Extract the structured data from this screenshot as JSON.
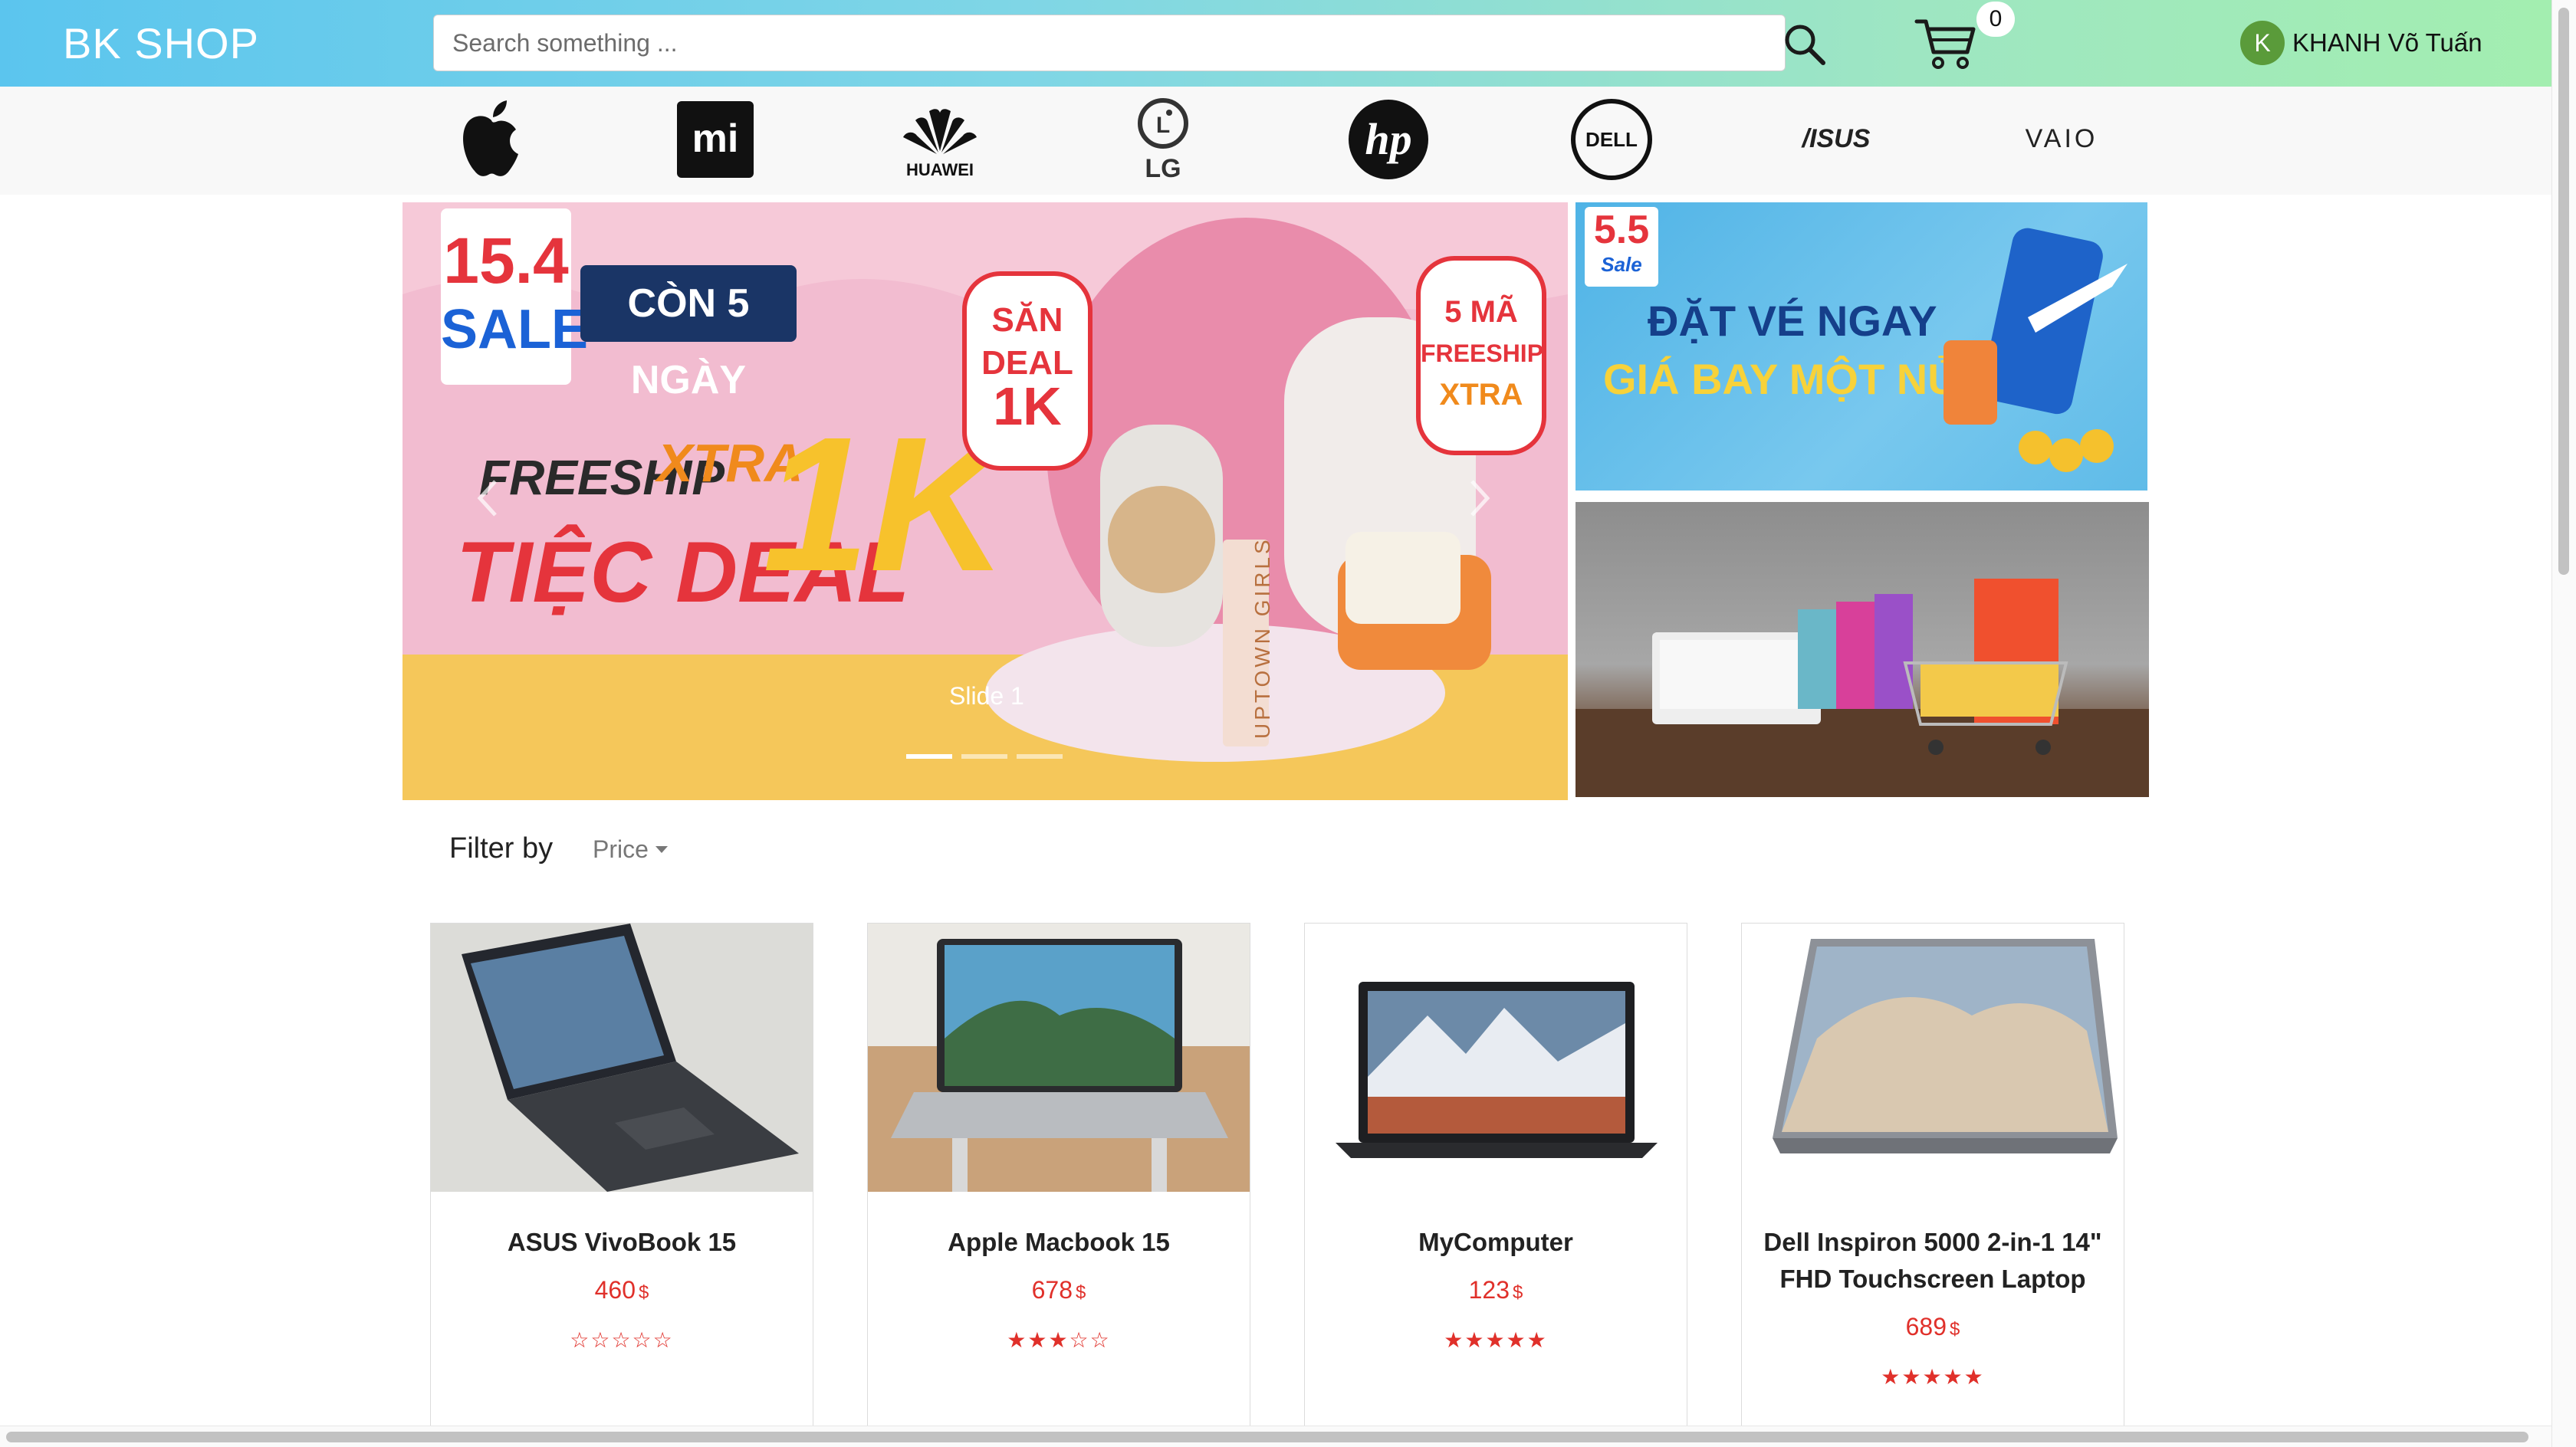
{
  "header": {
    "brand": "BK SHOP",
    "search_placeholder": "Search something ...",
    "cart_count": "0",
    "user_initial": "K",
    "user_name": "KHANH Võ Tuấn"
  },
  "brands": [
    {
      "name": "apple",
      "label": ""
    },
    {
      "name": "xiaomi",
      "label": "mi"
    },
    {
      "name": "huawei",
      "label": "HUAWEI"
    },
    {
      "name": "lg",
      "label": "LG"
    },
    {
      "name": "hp",
      "label": "hp"
    },
    {
      "name": "dell",
      "label": "DELL"
    },
    {
      "name": "asus",
      "label": "/ISUS"
    },
    {
      "name": "vaio",
      "label": "VAIO"
    }
  ],
  "banner": {
    "main": {
      "date": "15.4",
      "sale": "SALE",
      "countdown": "CÒN 5 NGÀY",
      "freeship": "FREESHIP",
      "xtra": "XTRA",
      "deal": "TIỆC DEAL",
      "amount": "1K",
      "san_deal": [
        "SĂN",
        "DEAL",
        "1K"
      ],
      "ma_freeship": [
        "5 MÃ",
        "FREESHIP",
        "XTRA"
      ],
      "product_text": "UPTOWN GIRLS"
    },
    "slide_label": "Slide 1",
    "side1": {
      "badge": "5.5",
      "badge_sub": "Sale",
      "line1": "ĐẶT VÉ NGAY",
      "line2": "GIÁ BAY MỘT NỬA"
    }
  },
  "filter": {
    "label": "Filter by",
    "button": "Price"
  },
  "products": [
    {
      "name": "ASUS VivoBook 15",
      "price": "460",
      "currency": "$",
      "stars": "☆☆☆☆☆"
    },
    {
      "name": "Apple Macbook 15",
      "price": "678",
      "currency": "$",
      "stars": "★★★☆☆"
    },
    {
      "name": "MyComputer",
      "price": "123",
      "currency": "$",
      "stars": "★★★★★"
    },
    {
      "name": "Dell Inspiron 5000 2-in-1 14\" FHD Touchscreen Laptop",
      "price": "689",
      "currency": "$",
      "stars": "★★★★★"
    }
  ],
  "colors": {
    "accent_red": "#e0302a",
    "header_start": "#5bc5ee",
    "header_end": "#a3eeb0"
  }
}
